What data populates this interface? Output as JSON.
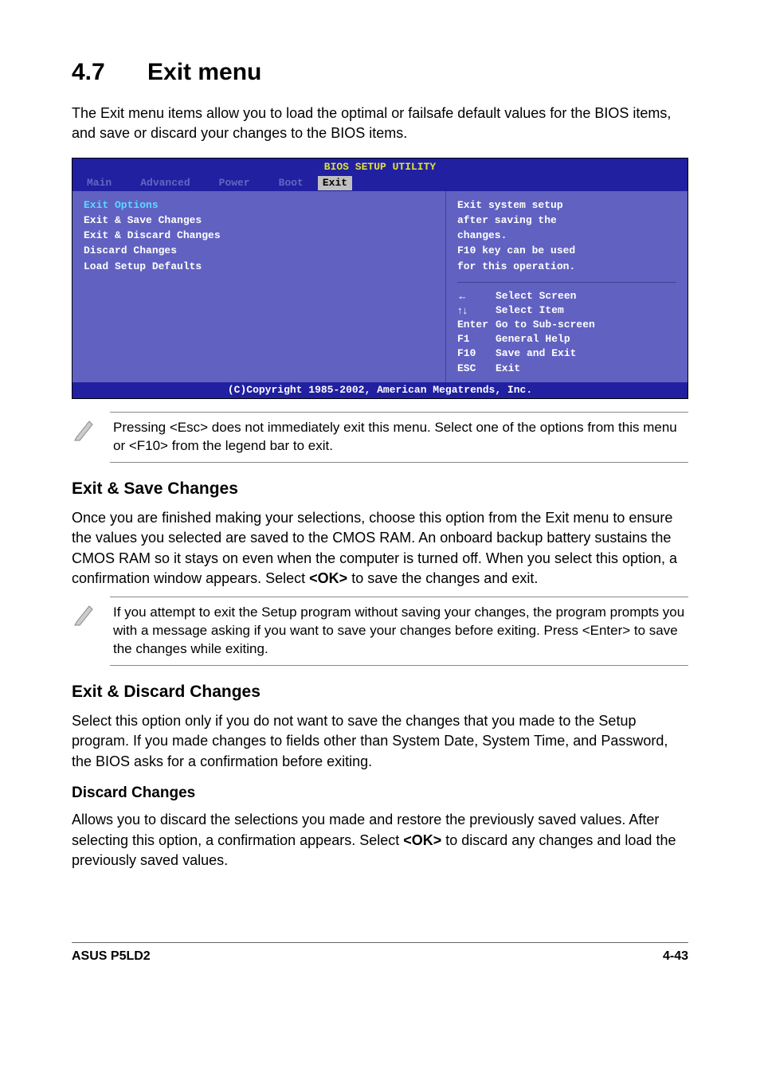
{
  "heading": {
    "number": "4.7",
    "title": "Exit menu"
  },
  "intro": "The Exit menu items allow you to load the optimal or failsafe default values for the BIOS items, and save or discard your changes to the BIOS items.",
  "bios": {
    "title": "BIOS SETUP UTILITY",
    "tabs": [
      "Main",
      "Advanced",
      "Power",
      "Boot",
      "Exit"
    ],
    "left_title": "Exit Options",
    "left_items": [
      "Exit & Save Changes",
      "Exit & Discard Changes",
      "Discard Changes",
      "",
      "Load Setup Defaults"
    ],
    "right_top": [
      "Exit system setup",
      "after saving the",
      "changes.",
      "",
      "F10 key can be used",
      "for this operation."
    ],
    "right_bottom": [
      {
        "key": "←",
        "label": "Select Screen"
      },
      {
        "key": "↑↓",
        "label": "Select Item"
      },
      {
        "key": "Enter",
        "label": "Go to Sub-screen"
      },
      {
        "key": "F1",
        "label": "General Help"
      },
      {
        "key": "F10",
        "label": "Save and Exit"
      },
      {
        "key": "ESC",
        "label": "Exit"
      }
    ],
    "footer": "(C)Copyright 1985-2002, American Megatrends, Inc."
  },
  "note1": "Pressing <Esc> does not immediately exit this menu. Select one of the options from this menu or <F10> from the legend bar to exit.",
  "section1": {
    "title": "Exit & Save Changes",
    "para_a": "Once you are finished making your selections, choose this option from the Exit menu to ensure the values you selected are saved to the CMOS RAM. An onboard backup battery sustains the CMOS RAM so it stays on even when the computer is turned off. When you select this option, a confirmation window appears. Select ",
    "ok": "<OK>",
    "para_b": " to save the changes and exit."
  },
  "note2": "If you attempt to exit the Setup program without saving your changes, the program prompts you with a message asking if you want to save your changes before exiting. Press <Enter> to save the changes while exiting.",
  "section2": {
    "title": "Exit & Discard Changes",
    "para": "Select this option only if you do not want to save the changes that you made to the Setup program. If you made changes to fields other than System Date, System Time, and Password, the BIOS asks for a confirmation before exiting."
  },
  "section3": {
    "title": "Discard Changes",
    "para_a": "Allows you to discard the selections you made and restore the previously saved values. After selecting this option, a confirmation appears. Select ",
    "ok": "<OK>",
    "para_b": " to discard any changes and load the previously saved values."
  },
  "footer": {
    "left": "ASUS P5LD2",
    "right": "4-43"
  }
}
